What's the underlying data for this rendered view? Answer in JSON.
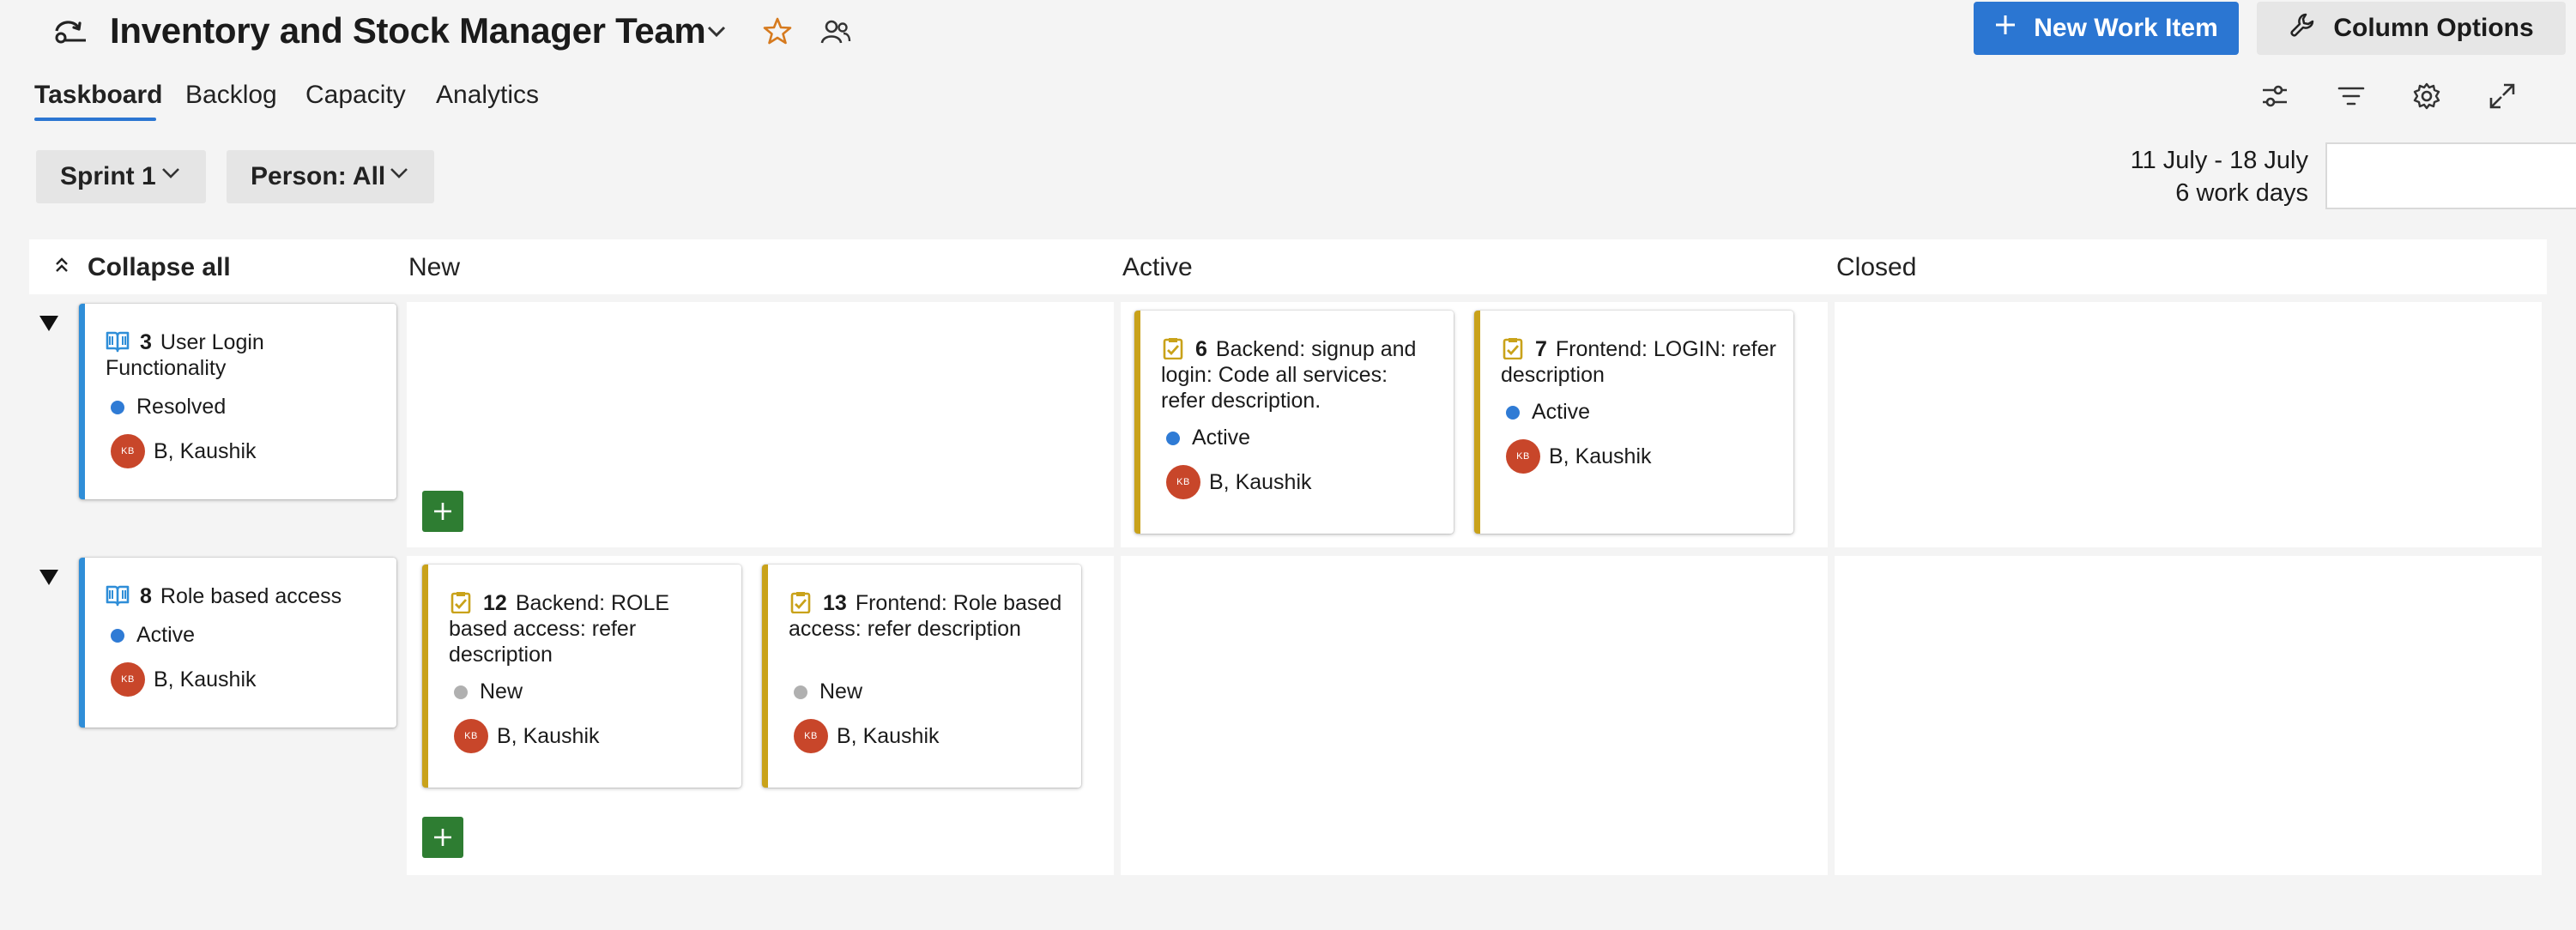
{
  "header": {
    "team_name": "Inventory and Stock Manager Team",
    "new_work_item_label": "New Work Item",
    "column_options_label": "Column Options"
  },
  "tabs": [
    {
      "label": "Taskboard",
      "selected": true
    },
    {
      "label": "Backlog",
      "selected": false
    },
    {
      "label": "Capacity",
      "selected": false
    },
    {
      "label": "Analytics",
      "selected": false
    }
  ],
  "filters": {
    "sprint": "Sprint 1",
    "person": "Person: All"
  },
  "sprint_info": {
    "date_range": "11 July - 18 July",
    "work_days": "6 work days"
  },
  "board": {
    "collapse_all_label": "Collapse all",
    "columns": [
      "New",
      "Active",
      "Closed"
    ],
    "lanes": [
      {
        "parent": {
          "id": "3",
          "title": "User Login Functionality",
          "state": "Resolved",
          "assignee": "B, Kaushik",
          "avatar_initials": "KB"
        },
        "cards": [
          {
            "id": "6",
            "title": "Backend: signup and login: Code all services: refer description.",
            "state": "Active",
            "assignee": "B, Kaushik",
            "avatar_initials": "KB"
          },
          {
            "id": "7",
            "title": "Frontend: LOGIN: refer description",
            "state": "Active",
            "assignee": "B, Kaushik",
            "avatar_initials": "KB"
          }
        ]
      },
      {
        "parent": {
          "id": "8",
          "title": "Role based access",
          "state": "Active",
          "assignee": "B, Kaushik",
          "avatar_initials": "KB"
        },
        "cards": [
          {
            "id": "12",
            "title": "Backend: ROLE based access: refer description",
            "state": "New",
            "assignee": "B, Kaushik",
            "avatar_initials": "KB"
          },
          {
            "id": "13",
            "title": "Frontend: Role based access: refer description",
            "state": "New",
            "assignee": "B, Kaushik",
            "avatar_initials": "KB"
          }
        ]
      }
    ]
  },
  "colors": {
    "accent": "#2b76d2",
    "add_button": "#2e7d32",
    "task_border": "#c9a21a",
    "story_border": "#2f8ed8",
    "state_active": "#2f7bd5",
    "state_resolved": "#2f7bd5",
    "state_new": "#b0b0b0",
    "avatar": "#c8462a"
  },
  "icons": {
    "team": "team-icon",
    "favorite": "star-icon",
    "members": "people-icon",
    "settings_sliders": "sliders-icon",
    "filter": "filter-icon",
    "settings": "gear-icon",
    "fullscreen": "expand-icon",
    "story": "book-icon",
    "task": "clipboard-check-icon"
  }
}
